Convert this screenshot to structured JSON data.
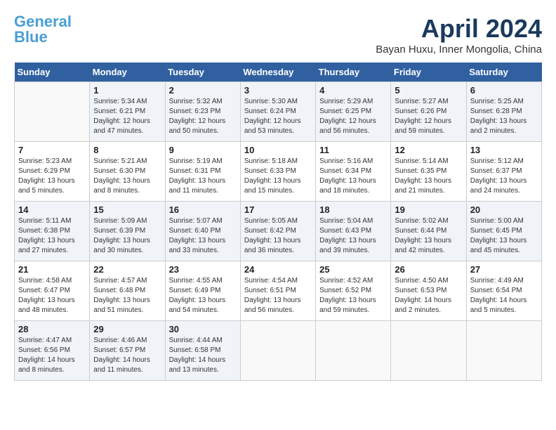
{
  "logo": {
    "line1": "General",
    "line2": "Blue",
    "tagline": ""
  },
  "title": "April 2024",
  "location": "Bayan Huxu, Inner Mongolia, China",
  "days_of_week": [
    "Sunday",
    "Monday",
    "Tuesday",
    "Wednesday",
    "Thursday",
    "Friday",
    "Saturday"
  ],
  "weeks": [
    [
      {
        "day": "",
        "info": ""
      },
      {
        "day": "1",
        "info": "Sunrise: 5:34 AM\nSunset: 6:21 PM\nDaylight: 12 hours\nand 47 minutes."
      },
      {
        "day": "2",
        "info": "Sunrise: 5:32 AM\nSunset: 6:23 PM\nDaylight: 12 hours\nand 50 minutes."
      },
      {
        "day": "3",
        "info": "Sunrise: 5:30 AM\nSunset: 6:24 PM\nDaylight: 12 hours\nand 53 minutes."
      },
      {
        "day": "4",
        "info": "Sunrise: 5:29 AM\nSunset: 6:25 PM\nDaylight: 12 hours\nand 56 minutes."
      },
      {
        "day": "5",
        "info": "Sunrise: 5:27 AM\nSunset: 6:26 PM\nDaylight: 12 hours\nand 59 minutes."
      },
      {
        "day": "6",
        "info": "Sunrise: 5:25 AM\nSunset: 6:28 PM\nDaylight: 13 hours\nand 2 minutes."
      }
    ],
    [
      {
        "day": "7",
        "info": "Sunrise: 5:23 AM\nSunset: 6:29 PM\nDaylight: 13 hours\nand 5 minutes."
      },
      {
        "day": "8",
        "info": "Sunrise: 5:21 AM\nSunset: 6:30 PM\nDaylight: 13 hours\nand 8 minutes."
      },
      {
        "day": "9",
        "info": "Sunrise: 5:19 AM\nSunset: 6:31 PM\nDaylight: 13 hours\nand 11 minutes."
      },
      {
        "day": "10",
        "info": "Sunrise: 5:18 AM\nSunset: 6:33 PM\nDaylight: 13 hours\nand 15 minutes."
      },
      {
        "day": "11",
        "info": "Sunrise: 5:16 AM\nSunset: 6:34 PM\nDaylight: 13 hours\nand 18 minutes."
      },
      {
        "day": "12",
        "info": "Sunrise: 5:14 AM\nSunset: 6:35 PM\nDaylight: 13 hours\nand 21 minutes."
      },
      {
        "day": "13",
        "info": "Sunrise: 5:12 AM\nSunset: 6:37 PM\nDaylight: 13 hours\nand 24 minutes."
      }
    ],
    [
      {
        "day": "14",
        "info": "Sunrise: 5:11 AM\nSunset: 6:38 PM\nDaylight: 13 hours\nand 27 minutes."
      },
      {
        "day": "15",
        "info": "Sunrise: 5:09 AM\nSunset: 6:39 PM\nDaylight: 13 hours\nand 30 minutes."
      },
      {
        "day": "16",
        "info": "Sunrise: 5:07 AM\nSunset: 6:40 PM\nDaylight: 13 hours\nand 33 minutes."
      },
      {
        "day": "17",
        "info": "Sunrise: 5:05 AM\nSunset: 6:42 PM\nDaylight: 13 hours\nand 36 minutes."
      },
      {
        "day": "18",
        "info": "Sunrise: 5:04 AM\nSunset: 6:43 PM\nDaylight: 13 hours\nand 39 minutes."
      },
      {
        "day": "19",
        "info": "Sunrise: 5:02 AM\nSunset: 6:44 PM\nDaylight: 13 hours\nand 42 minutes."
      },
      {
        "day": "20",
        "info": "Sunrise: 5:00 AM\nSunset: 6:45 PM\nDaylight: 13 hours\nand 45 minutes."
      }
    ],
    [
      {
        "day": "21",
        "info": "Sunrise: 4:58 AM\nSunset: 6:47 PM\nDaylight: 13 hours\nand 48 minutes."
      },
      {
        "day": "22",
        "info": "Sunrise: 4:57 AM\nSunset: 6:48 PM\nDaylight: 13 hours\nand 51 minutes."
      },
      {
        "day": "23",
        "info": "Sunrise: 4:55 AM\nSunset: 6:49 PM\nDaylight: 13 hours\nand 54 minutes."
      },
      {
        "day": "24",
        "info": "Sunrise: 4:54 AM\nSunset: 6:51 PM\nDaylight: 13 hours\nand 56 minutes."
      },
      {
        "day": "25",
        "info": "Sunrise: 4:52 AM\nSunset: 6:52 PM\nDaylight: 13 hours\nand 59 minutes."
      },
      {
        "day": "26",
        "info": "Sunrise: 4:50 AM\nSunset: 6:53 PM\nDaylight: 14 hours\nand 2 minutes."
      },
      {
        "day": "27",
        "info": "Sunrise: 4:49 AM\nSunset: 6:54 PM\nDaylight: 14 hours\nand 5 minutes."
      }
    ],
    [
      {
        "day": "28",
        "info": "Sunrise: 4:47 AM\nSunset: 6:56 PM\nDaylight: 14 hours\nand 8 minutes."
      },
      {
        "day": "29",
        "info": "Sunrise: 4:46 AM\nSunset: 6:57 PM\nDaylight: 14 hours\nand 11 minutes."
      },
      {
        "day": "30",
        "info": "Sunrise: 4:44 AM\nSunset: 6:58 PM\nDaylight: 14 hours\nand 13 minutes."
      },
      {
        "day": "",
        "info": ""
      },
      {
        "day": "",
        "info": ""
      },
      {
        "day": "",
        "info": ""
      },
      {
        "day": "",
        "info": ""
      }
    ]
  ]
}
